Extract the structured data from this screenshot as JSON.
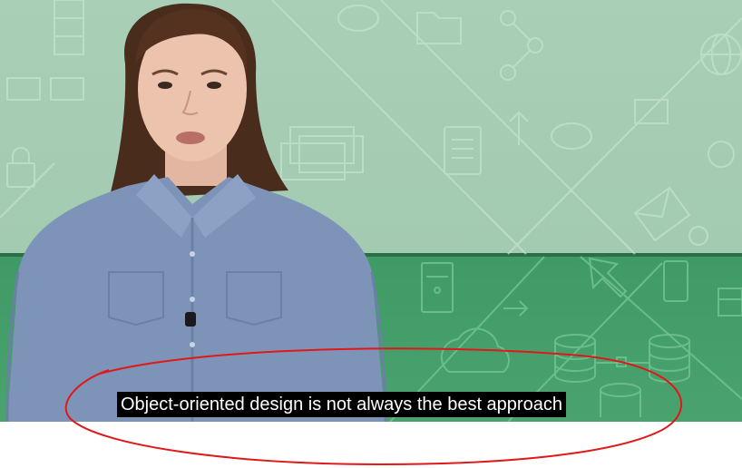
{
  "video": {
    "caption": "Object-oriented design is not always the best approach"
  },
  "annotation": {
    "color": "#e01818",
    "shape": "ellipse"
  },
  "icons": [
    "document-icon",
    "folder-icon",
    "network-icon",
    "globe-icon",
    "cloud-icon",
    "database-icon",
    "envelope-icon",
    "lock-icon",
    "monitor-icon",
    "chat-icon",
    "server-icon",
    "cursor-icon",
    "mobile-icon"
  ]
}
